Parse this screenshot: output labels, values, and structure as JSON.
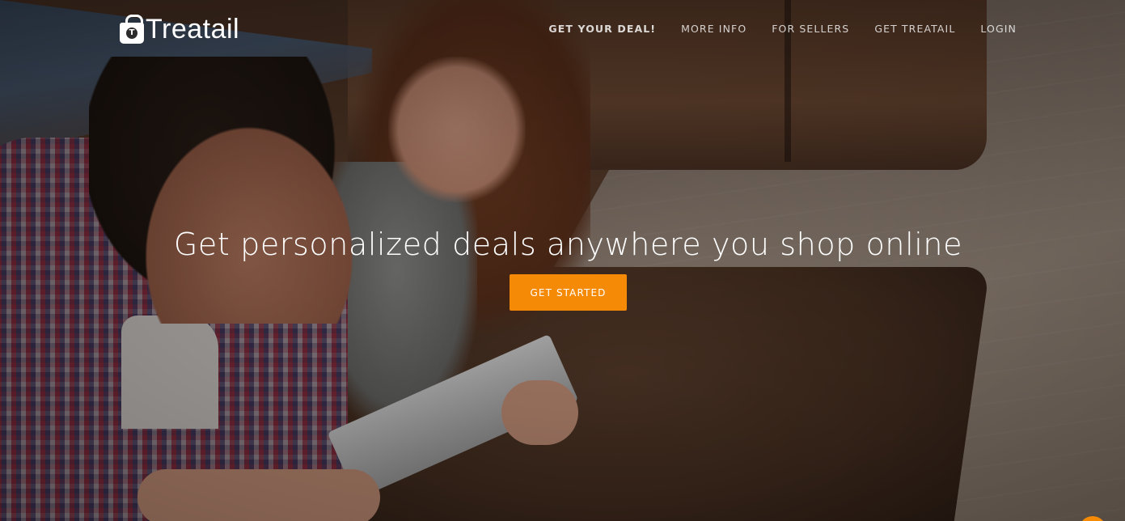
{
  "brand": {
    "name": "Treatail",
    "logo_icon": "shopping-bag-icon",
    "logo_badge": "T"
  },
  "nav": {
    "items": [
      {
        "label": "GET YOUR DEAL!",
        "active": true
      },
      {
        "label": "MORE INFO",
        "active": false
      },
      {
        "label": "FOR SELLERS",
        "active": false
      },
      {
        "label": "GET TREATAIL",
        "active": false
      },
      {
        "label": "LOGIN",
        "active": false
      }
    ]
  },
  "hero": {
    "headline": "Get personalized deals anywhere you shop online",
    "cta_label": "GET STARTED",
    "background": "couple-on-sofa-with-tablet-photo"
  },
  "colors": {
    "accent": "#f58a07",
    "text": "#ffffff"
  }
}
